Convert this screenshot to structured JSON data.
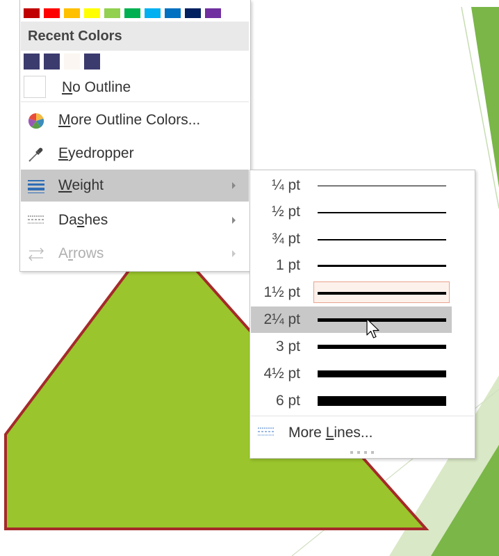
{
  "palette": {
    "standard_colors": [
      "#c00000",
      "#ff0000",
      "#ffc000",
      "#ffff00",
      "#92d050",
      "#00b050",
      "#00b0f0",
      "#0070c0",
      "#002060",
      "#7030a0"
    ],
    "recent_header": "Recent Colors",
    "recent_colors": [
      "#3c3b6e",
      "#3c3b6e",
      "#fbf6f1",
      "#3c3b6e"
    ]
  },
  "menu": {
    "no_outline": {
      "pre": "",
      "u": "N",
      "post": "o Outline"
    },
    "more_colors": {
      "pre": "",
      "u": "M",
      "post": "ore Outline Colors..."
    },
    "eyedropper": {
      "pre": "",
      "u": "E",
      "post": "yedropper"
    },
    "weight": {
      "pre": "",
      "u": "W",
      "post": "eight"
    },
    "dashes": {
      "pre": "Da",
      "u": "s",
      "post": "hes"
    },
    "arrows": {
      "pre": "A",
      "u": "r",
      "post": "rows"
    }
  },
  "weights": {
    "w0": "¼ pt",
    "w1": "½ pt",
    "w2": "¾ pt",
    "w3": "1 pt",
    "w4": "1½ pt",
    "w5": "2¼ pt",
    "w6": "3 pt",
    "w7": "4½ pt",
    "w8": "6 pt",
    "more_lines": {
      "pre": "More ",
      "u": "L",
      "post": "ines..."
    }
  },
  "colors": {
    "shape_fill": "#9ac52c",
    "shape_outline": "#a52a2a",
    "accent_green": "#7ab648",
    "menu_highlight": "#c8c8c8"
  },
  "icons": [
    "color-wheel-icon",
    "eyedropper-icon",
    "weight-lines-icon",
    "dashes-icon",
    "arrows-icon",
    "more-lines-icon",
    "cursor-pointer-icon"
  ]
}
